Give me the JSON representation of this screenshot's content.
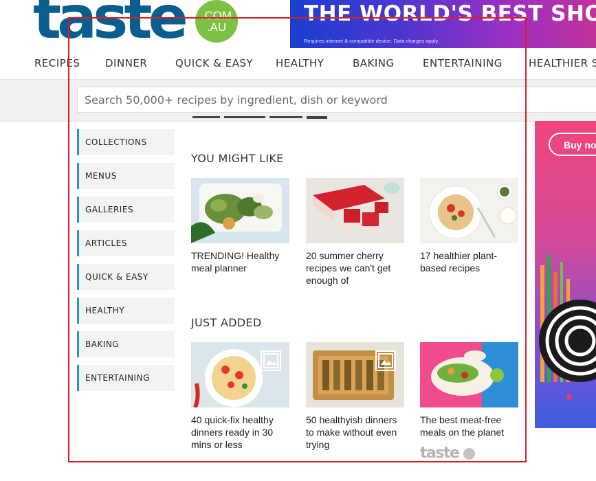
{
  "header": {
    "logo_word": "taste",
    "logo_badge_top": ".COM",
    "logo_badge_bottom": ".AU"
  },
  "banner": {
    "title": "THE WORLD'S BEST SHOWS",
    "fine_print": "Requires internet & compatible device. Data charges apply."
  },
  "nav": {
    "items": [
      "RECIPES",
      "DINNER",
      "QUICK & EASY",
      "HEALTHY",
      "BAKING",
      "ENTERTAINING",
      "HEALTHIER SU"
    ]
  },
  "search": {
    "placeholder": "Search 50,000+ recipes by ingredient, dish or keyword"
  },
  "sidebar": {
    "items": [
      "COLLECTIONS",
      "MENUS",
      "GALLERIES",
      "ARTICLES",
      "QUICK & EASY",
      "HEALTHY",
      "BAKING",
      "ENTERTAINING"
    ]
  },
  "you_might_like": {
    "title": "YOU MIGHT LIKE",
    "cards": [
      {
        "text": "TRENDING! Healthy meal planner",
        "image": "healthy-meal-photo"
      },
      {
        "text": "20 summer cherry recipes we can't get enough of",
        "image": "cherry-slice-photo"
      },
      {
        "text": "17 healthier plant-based recipes",
        "image": "pasta-bowl-photo"
      }
    ]
  },
  "just_added": {
    "title": "JUST ADDED",
    "cards": [
      {
        "text": "40 quick-fix healthy dinners ready in 30 mins or less",
        "image": "spaghetti-photo",
        "icon": "gallery-icon"
      },
      {
        "text": "50 healthyish dinners to make without even trying",
        "image": "tart-photo",
        "icon": "gallery-icon"
      },
      {
        "text": "The best meat-free meals on the planet",
        "image": "tacos-photo"
      }
    ]
  },
  "ad": {
    "button_label": "Buy now"
  },
  "footer": {
    "logo_word": "taste"
  },
  "colors": {
    "brand_blue": "#0a5d8f",
    "brand_green": "#7cc242",
    "sidebar_accent": "#2b8fd0",
    "annotation_red": "#d81f26"
  }
}
